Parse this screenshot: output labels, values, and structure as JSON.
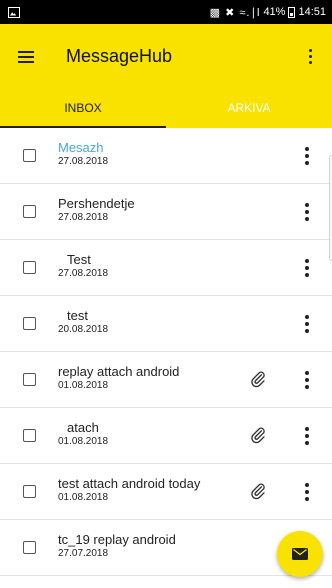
{
  "status_bar": {
    "signal_text": "⌁≁.∥l",
    "battery": "41%",
    "time": "14:51"
  },
  "app_bar": {
    "title": "MessageHub"
  },
  "tabs": [
    {
      "label": "INBOX",
      "active": true
    },
    {
      "label": "ARKIVA",
      "active": false
    }
  ],
  "messages": [
    {
      "subject": "Mesazh",
      "date": "27.08.2018",
      "unread": true,
      "attachment": false
    },
    {
      "subject": "Pershendetje",
      "date": "27.08.2018",
      "unread": false,
      "attachment": false
    },
    {
      "subject": "Test",
      "date": "27.08.2018",
      "unread": false,
      "attachment": false
    },
    {
      "subject": "test",
      "date": "20.08.2018",
      "unread": false,
      "attachment": false
    },
    {
      "subject": "replay attach android",
      "date": "01.08.2018",
      "unread": false,
      "attachment": true
    },
    {
      "subject": "atach",
      "date": "01.08.2018",
      "unread": false,
      "attachment": true
    },
    {
      "subject": "test attach android today",
      "date": "01.08.2018",
      "unread": false,
      "attachment": true
    },
    {
      "subject": "tc_19 replay android",
      "date": "27.07.2018",
      "unread": false,
      "attachment": false
    }
  ],
  "colors": {
    "accent": "#f9e100",
    "unread": "#4aa8d8",
    "divider": "#e4e4e4"
  },
  "icons": {
    "menu": "menu-icon",
    "overflow": "more-vertical-icon",
    "attachment": "paperclip-icon",
    "compose": "envelope-icon"
  }
}
